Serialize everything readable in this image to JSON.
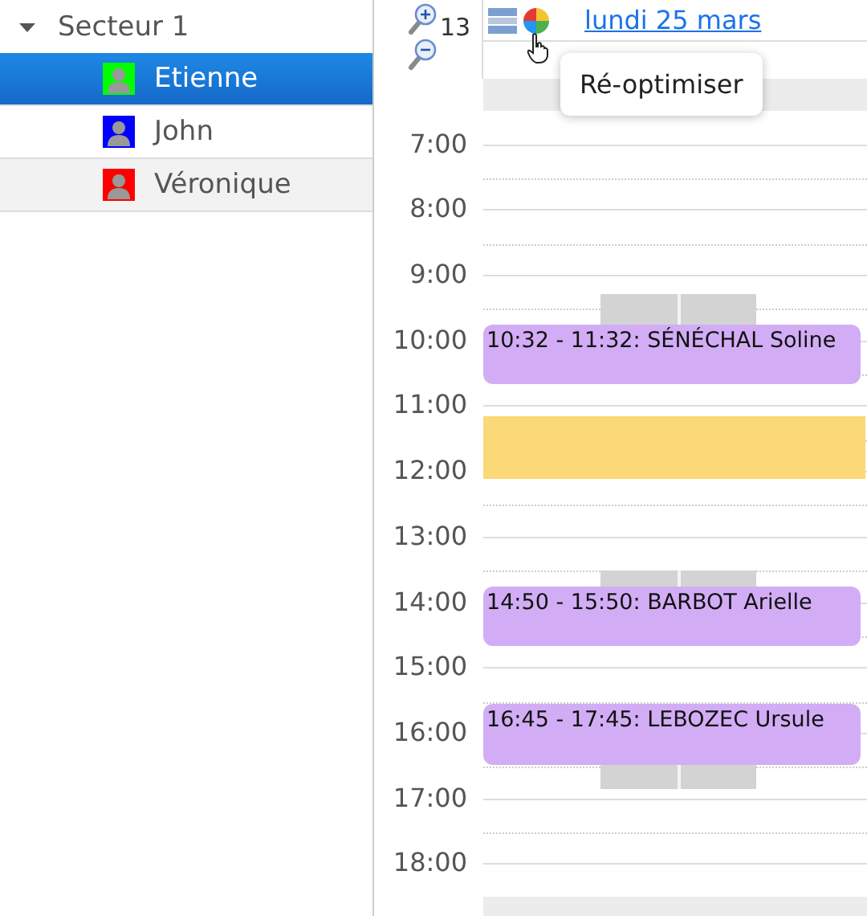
{
  "sidebar": {
    "groups": [
      {
        "label": "Secteur 1",
        "expanded": true,
        "children": [
          {
            "label": "Etienne",
            "color": "#00ff00",
            "selected": true,
            "highlighted": false
          },
          {
            "label": "John",
            "color": "#0000ff",
            "selected": false,
            "highlighted": false
          },
          {
            "label": "Véronique",
            "color": "#ff0000",
            "selected": false,
            "highlighted": true
          }
        ]
      }
    ]
  },
  "calendar": {
    "zoom": "13",
    "date_link": "lundi 25 mars",
    "tooltip": "Ré-optimiser",
    "hours": [
      "7:00",
      "8:00",
      "9:00",
      "10:00",
      "11:00",
      "12:00",
      "13:00",
      "14:00",
      "15:00",
      "16:00",
      "17:00",
      "18:00"
    ],
    "events": [
      {
        "kind": "unavailable"
      },
      {
        "kind": "unavailable"
      },
      {
        "kind": "unavailable"
      },
      {
        "kind": "appointment",
        "text": "10:32 - 11:32: SÉNÉCHAL Soline"
      },
      {
        "kind": "reserved"
      },
      {
        "kind": "appointment",
        "text": "14:50 - 15:50: BARBOT Arielle"
      },
      {
        "kind": "appointment",
        "text": "16:45 - 17:45: LEBOZEC Ursule"
      }
    ]
  }
}
